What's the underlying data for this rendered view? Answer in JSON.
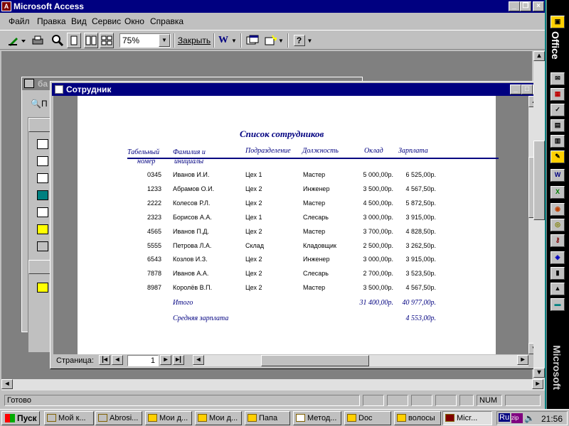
{
  "app": {
    "title": "Microsoft Access"
  },
  "menu": [
    "Файл",
    "Правка",
    "Вид",
    "Сервис",
    "Окно",
    "Справка"
  ],
  "toolbar": {
    "zoom_value": "75%",
    "close_label": "Закрыть"
  },
  "db_window": {
    "title": "ба",
    "toolbar_text": "П"
  },
  "report_window": {
    "title": "Сотрудник",
    "page_label": "Страница:",
    "page_value": "1"
  },
  "report": {
    "title": "Список сотрудников",
    "headers": {
      "tab_no_1": "Табельный",
      "tab_no_2": "номер",
      "name_1": "Фамилия и",
      "name_2": "инициалы",
      "dept": "Подразделение",
      "position": "Должность",
      "salary": "Оклад",
      "pay": "Зарплата"
    },
    "rows": [
      {
        "tab": "0345",
        "name": "Иванов И.И.",
        "dept": "Цех 1",
        "pos": "Мастер",
        "salary": "5 000,00р.",
        "pay": "6 525,00р."
      },
      {
        "tab": "1233",
        "name": "Абрамов О.И.",
        "dept": "Цех 2",
        "pos": "Инженер",
        "salary": "3 500,00р.",
        "pay": "4 567,50р."
      },
      {
        "tab": "2222",
        "name": "Колесов Р.Л.",
        "dept": "Цех 2",
        "pos": "Мастер",
        "salary": "4 500,00р.",
        "pay": "5 872,50р."
      },
      {
        "tab": "2323",
        "name": "Борисов А.А.",
        "dept": "Цех 1",
        "pos": "Слесарь",
        "salary": "3 000,00р.",
        "pay": "3 915,00р."
      },
      {
        "tab": "4565",
        "name": "Иванов П.Д.",
        "dept": "Цех 2",
        "pos": "Мастер",
        "salary": "3 700,00р.",
        "pay": "4 828,50р."
      },
      {
        "tab": "5555",
        "name": "Петрова Л.А.",
        "dept": "Склад",
        "pos": "Кладовщик",
        "salary": "2 500,00р.",
        "pay": "3 262,50р."
      },
      {
        "tab": "6543",
        "name": "Козлов И.З.",
        "dept": "Цех 2",
        "pos": "Инженер",
        "salary": "3 000,00р.",
        "pay": "3 915,00р."
      },
      {
        "tab": "7878",
        "name": "Иванов А.А.",
        "dept": "Цех 2",
        "pos": "Слесарь",
        "salary": "2 700,00р.",
        "pay": "3 523,50р."
      },
      {
        "tab": "8987",
        "name": "Королёв В.П.",
        "dept": "Цех 2",
        "pos": "Мастер",
        "salary": "3 500,00р.",
        "pay": "4 567,50р."
      }
    ],
    "total_label": "Итого",
    "total_salary": "31 400,00р.",
    "total_pay": "40 977,00р.",
    "avg_label": "Средняя зарплата",
    "avg_pay": "4 553,00р."
  },
  "status": {
    "text": "Готово",
    "num": "NUM"
  },
  "office_bar": {
    "label_top": "Office",
    "label_bottom": "Microsoft"
  },
  "taskbar": {
    "start": "Пуск",
    "tasks": [
      "Мой к...",
      "Abrosi...",
      "Мои д...",
      "Мои д...",
      "Папа",
      "Метод...",
      "Doc",
      "волосы",
      "Micr..."
    ],
    "lang": "Ru",
    "clock": "21:56"
  },
  "colors": {
    "title_active": "#000080",
    "report_text": "#000080",
    "face": "#c0c0c0",
    "workspace": "#808080"
  }
}
